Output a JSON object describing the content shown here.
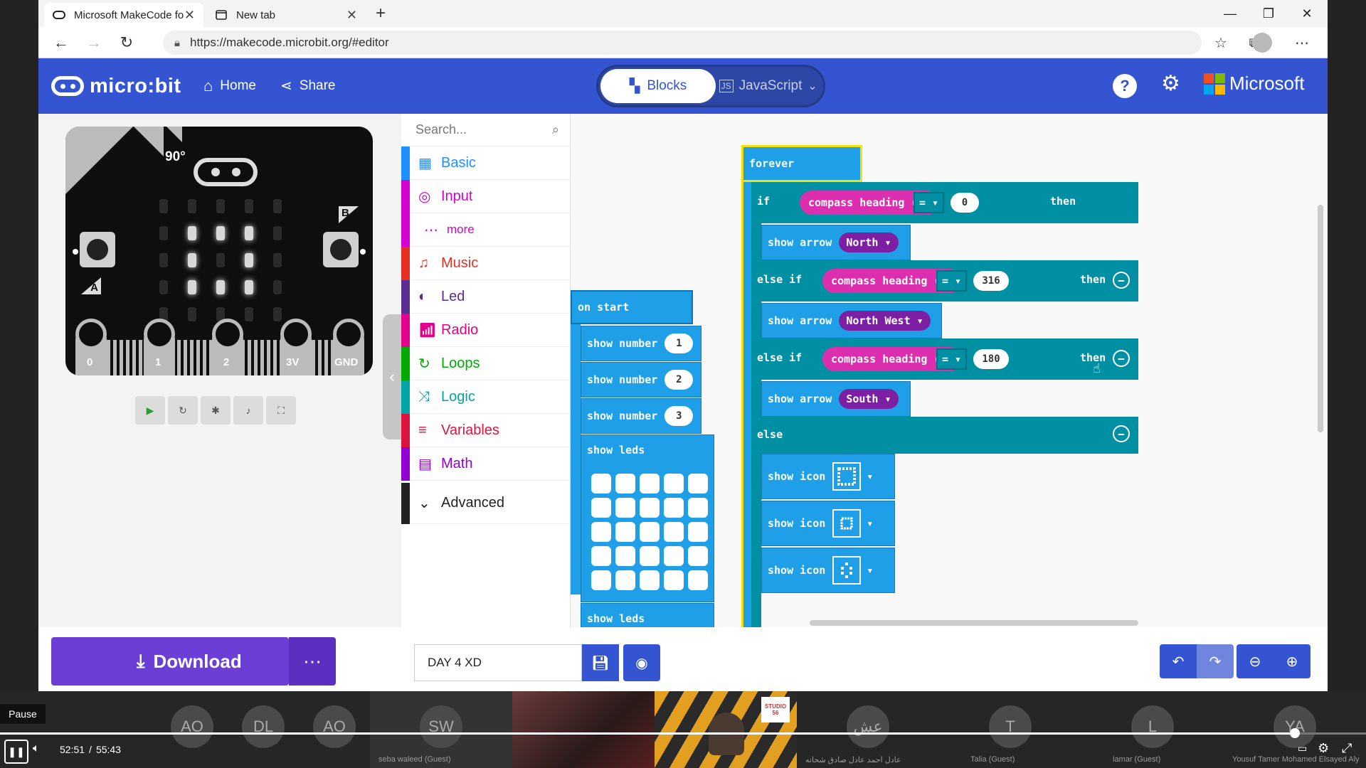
{
  "browser": {
    "tabs": [
      {
        "title": "Microsoft MakeCode for micro:bit",
        "icon": "makecode-icon"
      },
      {
        "title": "New tab",
        "icon": "newtab-icon"
      }
    ],
    "url": "https://makecode.microbit.org/#editor"
  },
  "menubar": {
    "logo": "micro:bit",
    "home": "Home",
    "share": "Share",
    "blocks": "Blocks",
    "javascript": "JavaScript",
    "brand": "Microsoft",
    "colors": {
      "menubar": "#3454d1",
      "download": "#6b3fd6"
    }
  },
  "simulator": {
    "heading": "90°",
    "button_a": "A",
    "button_b": "B",
    "pins": [
      "0",
      "1",
      "2",
      "3V",
      "GND"
    ],
    "leds_on": [
      [
        1,
        1
      ],
      [
        1,
        2
      ],
      [
        1,
        3
      ],
      [
        2,
        1
      ],
      [
        2,
        3
      ],
      [
        3,
        1
      ],
      [
        3,
        2
      ],
      [
        3,
        3
      ]
    ]
  },
  "toolbox": {
    "search_placeholder": "Search...",
    "categories": [
      {
        "label": "Basic",
        "color": "#1e90ff"
      },
      {
        "label": "Input",
        "color": "#d400d4"
      },
      {
        "label": "more",
        "color": "#d400d4"
      },
      {
        "label": "Music",
        "color": "#e63022"
      },
      {
        "label": "Led",
        "color": "#5c2d91"
      },
      {
        "label": "Radio",
        "color": "#e3008c"
      },
      {
        "label": "Loops",
        "color": "#00aa00"
      },
      {
        "label": "Logic",
        "color": "#00a4a6"
      },
      {
        "label": "Variables",
        "color": "#dc143c"
      },
      {
        "label": "Math",
        "color": "#9400d3"
      }
    ],
    "advanced": "Advanced"
  },
  "workspace": {
    "on_start": {
      "label": "on start",
      "show_number": "show number",
      "numbers": [
        "1",
        "2",
        "3"
      ],
      "show_leds": "show leds"
    },
    "forever": {
      "label": "forever",
      "if": "if",
      "else_if": "else if",
      "else": "else",
      "then": "then",
      "compass": "compass heading (°)",
      "op": "=",
      "values": [
        "0",
        "316",
        "180"
      ],
      "show_arrow": "show arrow",
      "arrows": [
        "North",
        "North West",
        "South"
      ],
      "show_icon": "show icon"
    }
  },
  "bottombar": {
    "download": "Download",
    "project_name": "DAY 4 XD"
  },
  "call": {
    "participants": [
      {
        "initials": "AO",
        "name": ""
      },
      {
        "initials": "DL",
        "name": ""
      },
      {
        "initials": "AO",
        "name": ""
      },
      {
        "initials": "SW",
        "name": "seba waleed (Guest)"
      },
      {
        "initials": "عش",
        "name": "عادل احمد عادل صادق شحاته"
      },
      {
        "initials": "T",
        "name": "Talia (Guest)"
      },
      {
        "initials": "L",
        "name": "lamar (Guest)"
      },
      {
        "initials": "YA",
        "name": "Yousuf Tamer Mohamed Elsayed Aly"
      }
    ],
    "studio_logo": "STUDIO 56"
  },
  "player": {
    "tooltip": "Pause",
    "current": "52:51",
    "total": "55:43",
    "progress": 0.948
  }
}
